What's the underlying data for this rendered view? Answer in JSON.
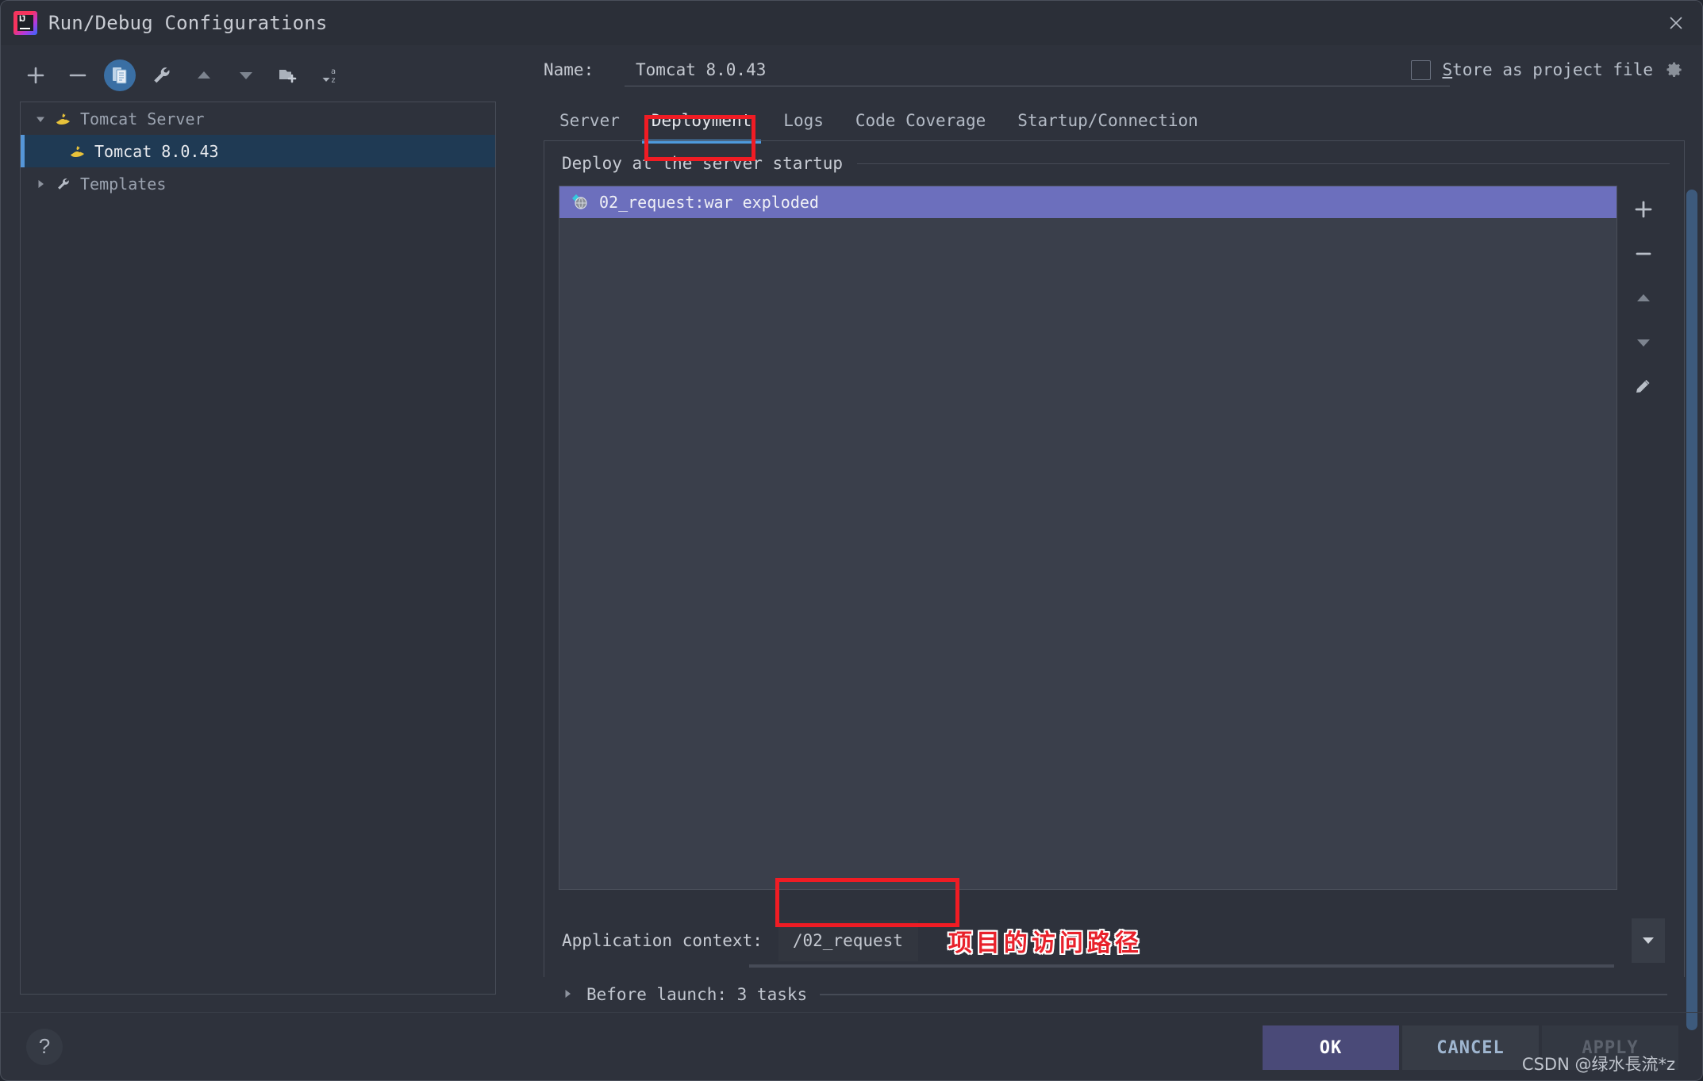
{
  "window": {
    "title": "Run/Debug Configurations",
    "logo_icon": "intellij-idea-logo",
    "close_icon": "close-icon"
  },
  "left_toolbar": {
    "buttons": [
      {
        "name": "add-configuration-button",
        "icon": "plus-icon",
        "active": false
      },
      {
        "name": "remove-configuration-button",
        "icon": "minus-icon",
        "active": false
      },
      {
        "name": "copy-configuration-button",
        "icon": "copy-icon",
        "active": true
      },
      {
        "name": "edit-templates-button",
        "icon": "wrench-icon",
        "active": false
      },
      {
        "name": "move-up-button",
        "icon": "arrow-up-icon",
        "active": false
      },
      {
        "name": "move-down-button",
        "icon": "arrow-down-icon",
        "active": false
      },
      {
        "name": "new-folder-button",
        "icon": "folder-add-icon",
        "active": false
      },
      {
        "name": "sort-configurations-button",
        "icon": "sort-az-icon",
        "active": false
      }
    ]
  },
  "tree": {
    "nodes": [
      {
        "label": "Tomcat Server",
        "icon": "tomcat-icon",
        "twisty": "expanded",
        "level": 0,
        "selected": false
      },
      {
        "label": "Tomcat 8.0.43",
        "icon": "tomcat-icon",
        "twisty": "none",
        "level": 1,
        "selected": true
      },
      {
        "label": "Templates",
        "icon": "wrench-icon",
        "twisty": "collapsed",
        "level": 0,
        "selected": false
      }
    ]
  },
  "name_row": {
    "label": "Name:",
    "value": "Tomcat 8.0.43",
    "placeholder": "Name"
  },
  "store_as_project_file": {
    "label_prefix": "S",
    "label_rest": "tore as project file",
    "checked": false,
    "gear_icon": "gear-icon"
  },
  "tabs": [
    {
      "label": "Server",
      "selected": false
    },
    {
      "label": "Deployment",
      "selected": true
    },
    {
      "label": "Logs",
      "selected": false
    },
    {
      "label": "Code Coverage",
      "selected": false
    },
    {
      "label": "Startup/Connection",
      "selected": false
    }
  ],
  "deployment": {
    "section_title": "Deploy at the server startup",
    "items": [
      {
        "label": "02_request:war exploded",
        "icon": "artifact-icon",
        "selected": true
      }
    ],
    "side_buttons": [
      {
        "name": "add-artifact-button",
        "icon": "plus-icon"
      },
      {
        "name": "remove-artifact-button",
        "icon": "minus-icon"
      },
      {
        "name": "move-artifact-up-button",
        "icon": "arrow-up-icon"
      },
      {
        "name": "move-artifact-down-button",
        "icon": "arrow-down-icon"
      },
      {
        "name": "edit-artifact-button",
        "icon": "pencil-icon"
      }
    ]
  },
  "application_context": {
    "label": "Application context:",
    "value": "/02_request",
    "dropdown_icon": "chevron-down-icon"
  },
  "annotations": {
    "chinese_note": "项目的访问路径",
    "red_color": "#f01c24"
  },
  "before_launch": {
    "label": "Before launch: 3 tasks",
    "twisty": "collapsed"
  },
  "footer": {
    "help_icon": "question-mark-icon",
    "help_label": "?",
    "ok_label": "OK",
    "cancel_label": "CANCEL",
    "apply_label": "APPLY",
    "watermark": "CSDN @绿水長流*z"
  },
  "theme": {
    "window_bg": "#2e323c",
    "titlebar_bg": "#2b2f38",
    "selection_blue": "#1f3a54",
    "accent_blue": "#4e9bde",
    "list_bg": "#3a3f4b",
    "deploy_selection": "#6c6fbd",
    "ok_button": "#4a4a78"
  }
}
